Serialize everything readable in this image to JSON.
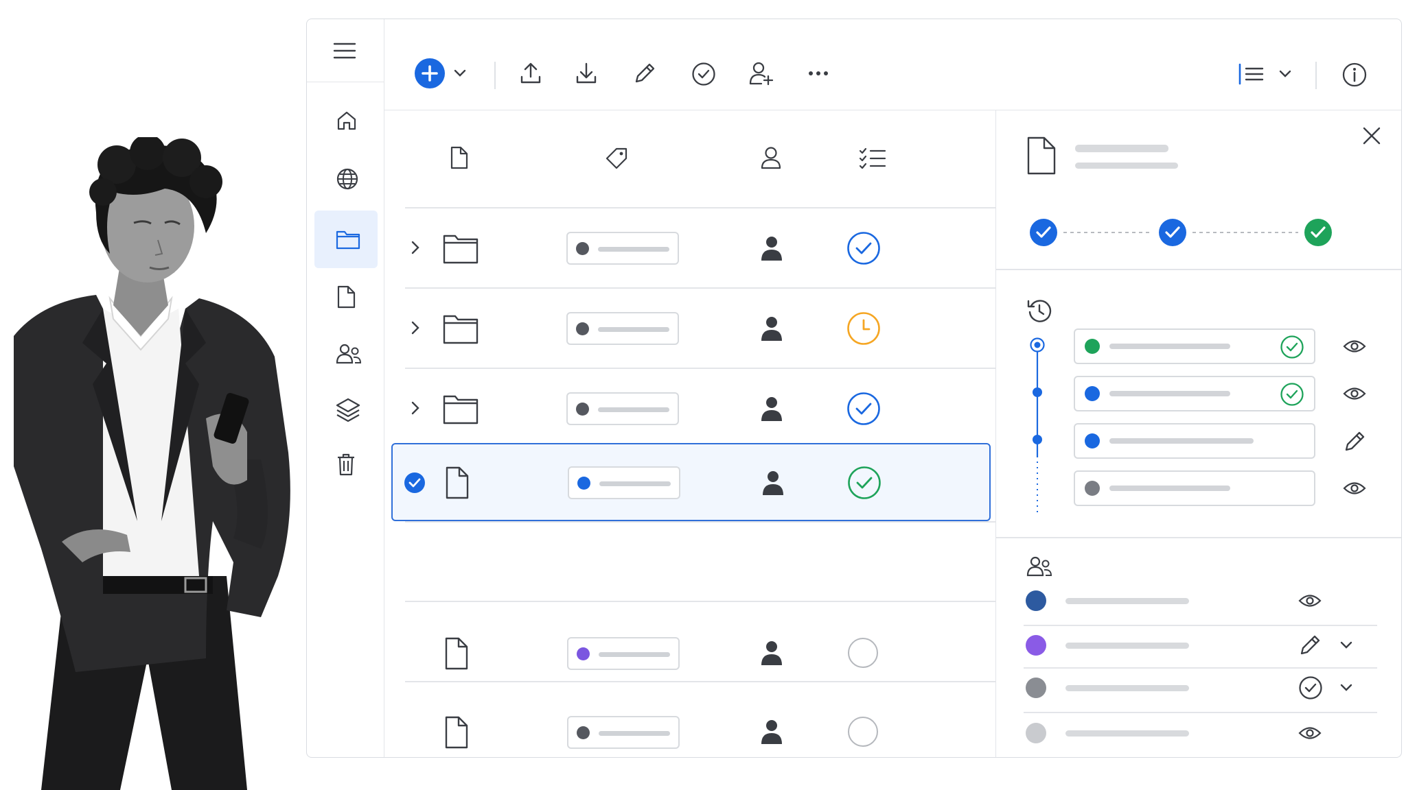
{
  "colors": {
    "accent": "#1a68e0",
    "success": "#1ea35a",
    "pending": "#f5a623",
    "purple": "#7b56e0",
    "gray": "#6d7078",
    "navy": "#2d5aa0",
    "selected_bg": "#f2f7fe",
    "selected_border": "#2f6fd9"
  },
  "toolbar": {
    "icons": [
      "add-icon",
      "chevron-down-icon",
      "upload-icon",
      "download-icon",
      "pencil-icon",
      "check-circle-icon",
      "add-user-icon",
      "more-icon",
      "list-view-icon",
      "chevron-down-icon",
      "info-icon"
    ]
  },
  "sidebar": {
    "items": [
      "menu-icon",
      "home-icon",
      "globe-icon",
      "folder-icon",
      "file-icon",
      "users-icon",
      "layers-icon",
      "trash-icon"
    ],
    "active": "folder-icon"
  },
  "grid": {
    "columns": [
      "file-icon",
      "tag-icon",
      "user-icon",
      "checklist-icon"
    ],
    "rows": [
      {
        "type": "folder",
        "expandable": true,
        "tag_color": "#55585f",
        "status": "approved"
      },
      {
        "type": "folder",
        "expandable": true,
        "tag_color": "#55585f",
        "status": "pending"
      },
      {
        "type": "folder",
        "expandable": true,
        "tag_color": "#55585f",
        "status": "approved"
      },
      {
        "type": "file",
        "selected": true,
        "tag_color": "#1a68e0",
        "status": "completed"
      },
      {
        "type": "file",
        "tag_color": "#7b56e0",
        "status": "empty"
      },
      {
        "type": "file",
        "tag_color": "#55585f",
        "status": "empty"
      }
    ]
  },
  "panel": {
    "workflow_steps": [
      "done",
      "done",
      "complete"
    ],
    "versions": [
      {
        "dot": "#1ea35a",
        "approved": true,
        "action": "eye-icon"
      },
      {
        "dot": "#1a68e0",
        "approved": true,
        "action": "eye-icon"
      },
      {
        "dot": "#1a68e0",
        "approved": false,
        "action": "pencil-icon"
      },
      {
        "dot": "#7a7d84",
        "approved": false,
        "action": "eye-icon"
      }
    ],
    "members": [
      {
        "color": "#2d5aa0",
        "permission": "eye-icon",
        "dropdown": false
      },
      {
        "color": "#8a5be6",
        "permission": "pencil-icon",
        "dropdown": true
      },
      {
        "color": "#8a8d93",
        "permission": "check-circle-icon",
        "dropdown": true
      },
      {
        "color": "#c9cbcf",
        "permission": "eye-icon",
        "dropdown": false
      }
    ]
  }
}
